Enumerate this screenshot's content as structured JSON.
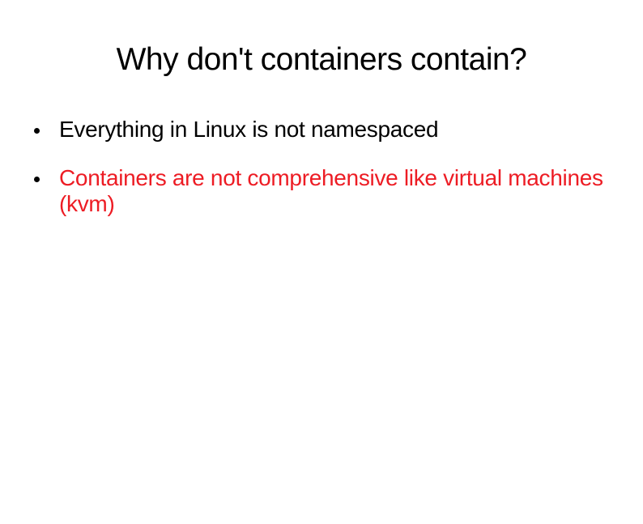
{
  "slide": {
    "title": "Why don't containers contain?",
    "bullets": [
      {
        "text": "Everything in Linux is not namespaced",
        "color": "black"
      },
      {
        "text": "Containers are not comprehensive like virtual machines (kvm)",
        "color": "red"
      }
    ]
  }
}
